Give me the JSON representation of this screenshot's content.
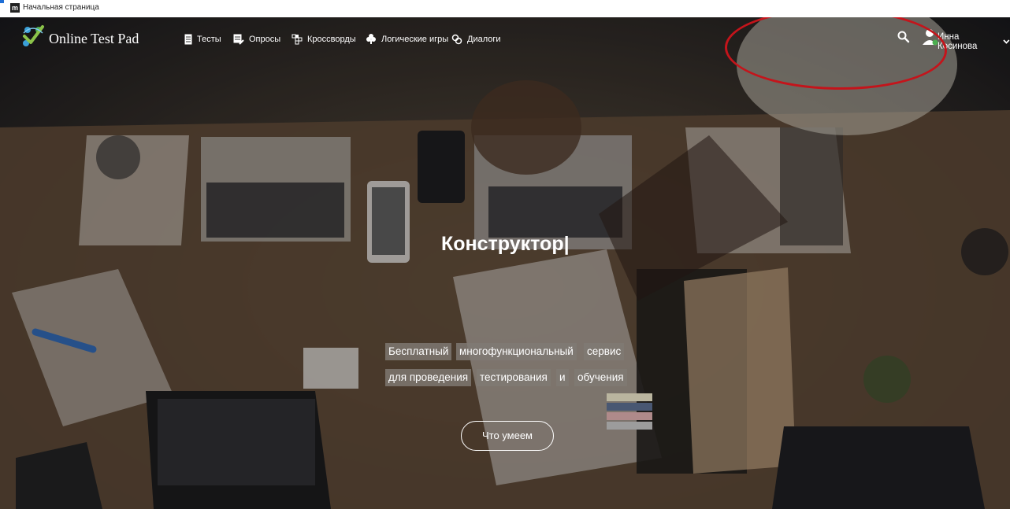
{
  "browser_tab": {
    "title": "Начальная страница",
    "favicon_letter": "m",
    "favicon_icon": "site-favicon"
  },
  "header": {
    "logo_text": "Online Test Pad",
    "nav": [
      {
        "label": "Тесты",
        "icon": "test-icon"
      },
      {
        "label": "Опросы",
        "icon": "poll-icon"
      },
      {
        "label": "Кроссворды",
        "icon": "crossword-icon"
      },
      {
        "label": "Логические игры",
        "icon": "puzzle-icon"
      },
      {
        "label": "Диалоги",
        "icon": "dialog-icon"
      }
    ],
    "user_name": "Инна Косинова"
  },
  "hero": {
    "headline": "Конструктор|",
    "tagline_words": [
      "Бесплатный",
      "многофункциональный",
      "сервис",
      "для проведения",
      "тестирования",
      "и",
      "обучения"
    ],
    "cta_label": "Что умеем"
  },
  "colors": {
    "annotation_ring": "#c4141b",
    "tag_background": "#807a74",
    "text": "#ffffff",
    "tab_accent": "#1f6fd6"
  }
}
